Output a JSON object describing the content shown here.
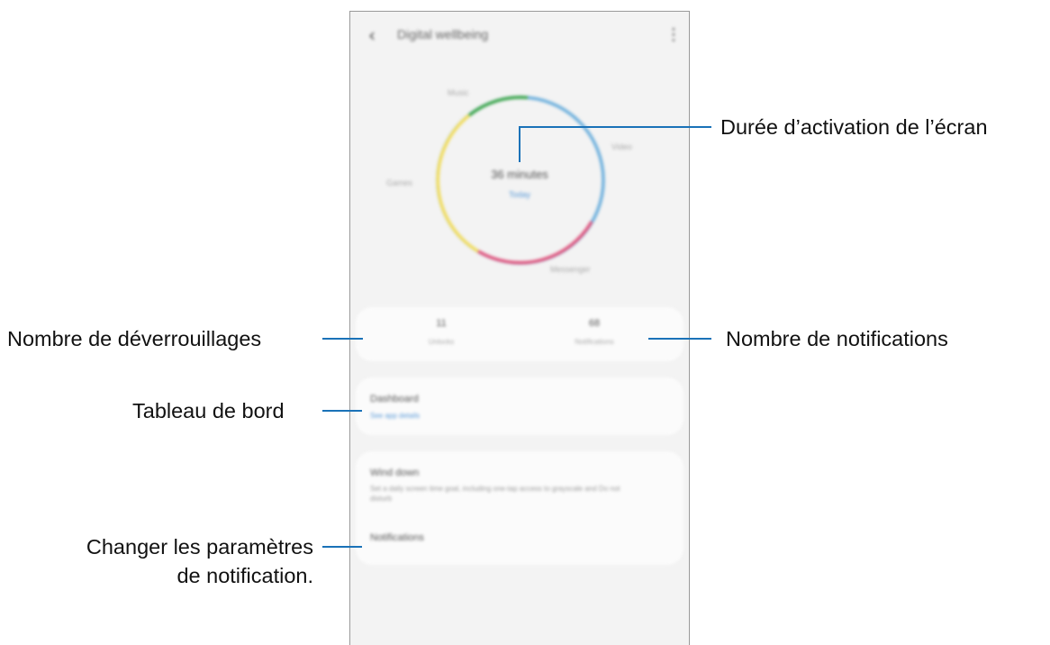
{
  "app": {
    "title": "Digital wellbeing"
  },
  "ring": {
    "time": "36 minutes",
    "period": "Today",
    "categories": [
      "Music",
      "Video",
      "Games",
      "Messenger"
    ],
    "colors": {
      "green": "#3aa54a",
      "blue": "#6aaedc",
      "pink": "#e0507a",
      "yellow": "#f2dc5a"
    }
  },
  "stats": {
    "unlocks": {
      "value": "11",
      "label": "Unlocks"
    },
    "notifications": {
      "value": "68",
      "label": "Notifications"
    }
  },
  "cards": {
    "dashboard": {
      "title": "Dashboard",
      "link": "See app details"
    },
    "wind_down": {
      "title": "Wind down",
      "subtitle": "Set a daily screen time goal, including one-tap access to grayscale and Do not disturb"
    },
    "notifications": {
      "title": "Notifications"
    }
  },
  "callouts": {
    "screen_time": "Durée d’activation de l’écran",
    "unlocks": "Nombre de déverrouillages",
    "notifications": "Nombre de notifications",
    "dashboard": "Tableau de bord",
    "change_notif_line1": "Changer les paramètres",
    "change_notif_line2": "de notification."
  }
}
